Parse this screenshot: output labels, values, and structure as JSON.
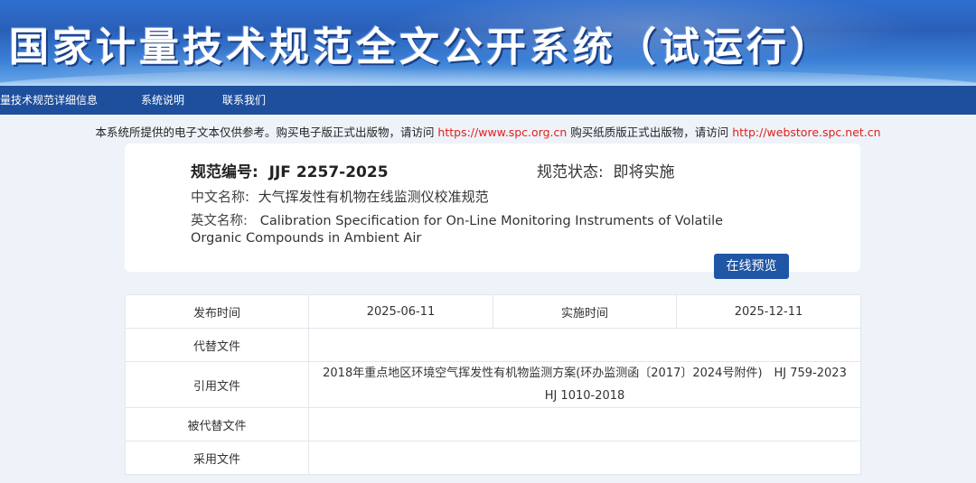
{
  "banner": {
    "title": "国家计量技术规范全文公开系统（试运行）"
  },
  "nav": {
    "items": [
      {
        "label": "计量技术规范详细信息"
      },
      {
        "label": "系统说明"
      },
      {
        "label": "联系我们"
      }
    ]
  },
  "notice": {
    "text1": "本系统所提供的电子文本仅供参考。购买电子版正式出版物，请访问 ",
    "link1": "https://www.spc.org.cn",
    "text2": " 购买纸质版正式出版物，请访问 ",
    "link2": "http://webstore.spc.net.cn"
  },
  "spec": {
    "code_label": "规范编号:",
    "code_value": "JJF 2257-2025",
    "status_label": "规范状态:",
    "status_value": "即将实施",
    "cn_label": "中文名称:",
    "cn_value": "大气挥发性有机物在线监测仪校准规范",
    "en_label": "英文名称:",
    "en_value": "Calibration Specification for On-Line Monitoring Instruments of Volatile Organic Compounds in Ambient Air",
    "preview_button": "在线预览"
  },
  "details": {
    "publish_label": "发布时间",
    "publish_value": "2025-06-11",
    "implement_label": "实施时间",
    "implement_value": "2025-12-11",
    "replaces_label": "代替文件",
    "replaces_value": "",
    "references_label": "引用文件",
    "references_value": "2018年重点地区环境空气挥发性有机物监测方案(环办监测函〔2017〕2024号附件)　HJ 759-2023　HJ 1010-2018",
    "replaced_by_label": "被代替文件",
    "replaced_by_value": "",
    "adopted_label": "采用文件",
    "adopted_value": ""
  },
  "colors": {
    "nav_bg": "#1e4f9d",
    "button_bg": "#1f56a6",
    "link": "#e0201a",
    "page_bg": "#eef3f9"
  }
}
